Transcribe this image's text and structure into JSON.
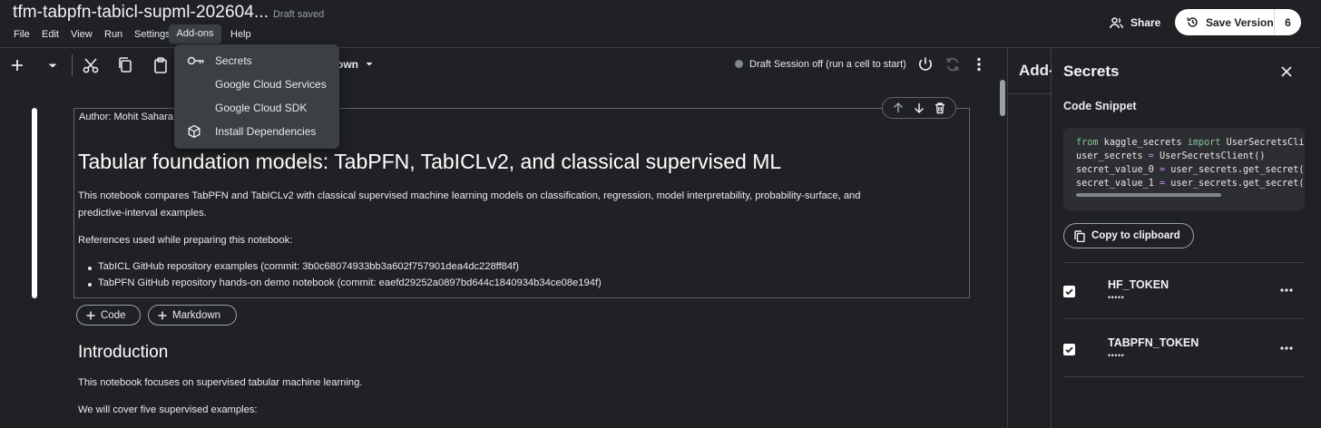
{
  "header": {
    "title": "tfm-tabpfn-tabicl-supml-202604...",
    "status": "Draft saved",
    "menu": [
      "File",
      "Edit",
      "View",
      "Run",
      "Settings",
      "Add-ons",
      "Help"
    ],
    "share_label": "Share",
    "save_version_label": "Save Version",
    "version_count": "6"
  },
  "toolbar": {
    "cell_type_fragment": "own",
    "session_status": "Draft Session off (run a cell to start)"
  },
  "addons_menu": {
    "items": [
      {
        "label": "Secrets",
        "icon": "key-icon"
      },
      {
        "label": "Google Cloud Services",
        "icon": ""
      },
      {
        "label": "Google Cloud SDK",
        "icon": ""
      },
      {
        "label": "Install Dependencies",
        "icon": "package-icon"
      }
    ]
  },
  "notebook": {
    "author": "Author: Mohit Sahara",
    "heading": "Tabular foundation models: TabPFN, TabICLv2, and classical supervised ML",
    "intro_line1": "This notebook compares TabPFN and TabICLv2 with classical supervised machine learning models on classification, regression, model interpretability, probability-surface, and",
    "intro_line2": "predictive-interval examples.",
    "refs_label": "References used while preparing this notebook:",
    "refs": [
      "TabICL GitHub repository examples (commit: 3b0c68074933bb3a602f757901dea4dc228ff84f)",
      "TabPFN GitHub repository hands-on demo notebook (commit: eaefd29252a0897bd644c1840934b34ce08e194f)"
    ],
    "add_code_label": "Code",
    "add_markdown_label": "Markdown",
    "section_heading": "Introduction",
    "section_p1": "This notebook focuses on supervised tabular machine learning.",
    "section_p2": "We will cover five supervised examples:"
  },
  "side_panel": {
    "peek_title": "Add-ons",
    "title": "Secrets",
    "code_snippet_label": "Code Snippet",
    "code": {
      "l1_kw1": "from",
      "l1_mod": " kaggle_secrets ",
      "l1_kw2": "import",
      "l1_rest": " UserSecretsClient",
      "l2_a": "user_secrets ",
      "l2_op": "=",
      "l2_b": " UserSecretsClient()",
      "l3_a": "secret_value_0 ",
      "l3_op": "=",
      "l3_b": " user_secrets.get_secret(\"HF_TOKEN\")",
      "l4_a": "secret_value_1 ",
      "l4_op": "=",
      "l4_b": " user_secrets.get_secret(\"TABPFN_TOKEN\")"
    },
    "copy_label": "Copy to clipboard",
    "secrets": [
      {
        "name": "HF_TOKEN",
        "mask": "•••••",
        "checked": true
      },
      {
        "name": "TABPFN_TOKEN",
        "mask": "•••••",
        "checked": true
      }
    ]
  },
  "colors": {
    "background": "#202124",
    "panel_border": "#3c4043",
    "code_keyword": "#81c995",
    "code_operator": "#c58af9"
  }
}
